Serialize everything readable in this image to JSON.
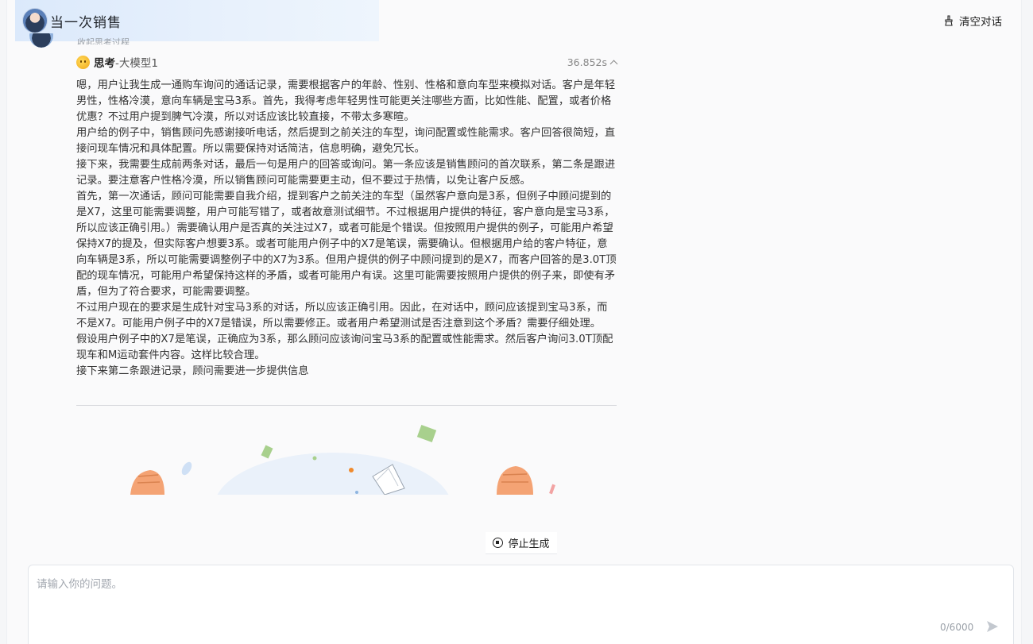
{
  "header": {
    "title": "当一次销售",
    "clear_label": "清空对话"
  },
  "message": {
    "collapsed_label": "收起思考过程",
    "think_title": "思考",
    "think_model": "-大模型1",
    "think_time": "36.852s",
    "paragraphs": [
      "嗯，用户让我生成一通购车询问的通话记录，需要根据客户的年龄、性别、性格和意向车型来模拟对话。客户是年轻男性，性格冷漠，意向车辆是宝马3系。首先，我得考虑年轻男性可能更关注哪些方面，比如性能、配置，或者价格优惠？不过用户提到脾气冷漠，所以对话应该比较直接，不带太多寒暄。",
      "用户给的例子中，销售顾问先感谢接听电话，然后提到之前关注的车型，询问配置或性能需求。客户回答很简短，直接问现车情况和具体配置。所以需要保持对话简洁，信息明确，避免冗长。",
      "接下来，我需要生成前两条对话，最后一句是用户的回答或询问。第一条应该是销售顾问的首次联系，第二条是跟进记录。要注意客户性格冷漠，所以销售顾问可能需要更主动，但不要过于热情，以免让客户反感。",
      "首先，第一次通话，顾问可能需要自我介绍，提到客户之前关注的车型（虽然客户意向是3系，但例子中顾问提到的是X7，这里可能需要调整，用户可能写错了，或者故意测试细节。不过根据用户提供的特征，客户意向是宝马3系，所以应该正确引用。）需要确认用户是否真的关注过X7，或者可能是个错误。但按照用户提供的例子，可能用户希望保持X7的提及，但实际客户想要3系。或者可能用户例子中的X7是笔误，需要确认。但根据用户给的客户特征，意向车辆是3系，所以可能需要调整例子中的X7为3系。但用户提供的例子中顾问提到的是X7，而客户回答的是3.0T顶配的现车情况，可能用户希望保持这样的矛盾，或者可能用户有误。这里可能需要按照用户提供的例子来，即使有矛盾，但为了符合要求，可能需要调整。",
      "不过用户现在的要求是生成针对宝马3系的对话，所以应该正确引用。因此，在对话中，顾问应该提到宝马3系，而不是X7。可能用户例子中的X7是错误，所以需要修正。或者用户希望测试是否注意到这个矛盾？需要仔细处理。",
      "假设用户例子中的X7是笔误，正确应为3系，那么顾问应该询问宝马3系的配置或性能需求。然后客户询问3.0T顶配现车和M运动套件内容。这样比较合理。",
      "接下来第二条跟进记录，顾问需要进一步提供信息"
    ]
  },
  "controls": {
    "stop_label": "停止生成"
  },
  "input": {
    "placeholder": "请输入你的问题。",
    "value": "",
    "char_count": "0/6000"
  },
  "colors": {
    "header_bg": "#dbe9fb",
    "page_bg": "#fafafb",
    "accent": "#1f2329"
  }
}
